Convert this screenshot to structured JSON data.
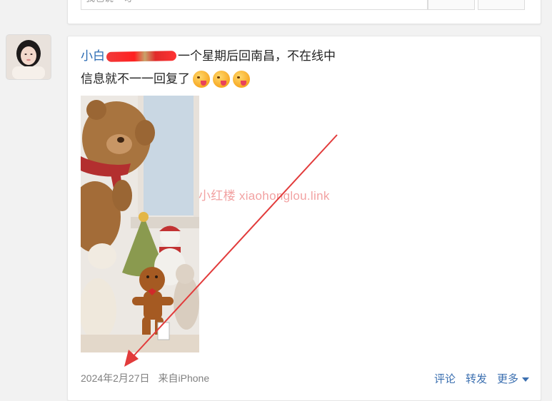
{
  "previous_post": {
    "input_placeholder": "我也说一句"
  },
  "post": {
    "username": "小白",
    "text_line1_after_redaction": "一个星期后回南昌，不在线中",
    "text_line2": "信息就不一一回复了",
    "emoji_count": 3,
    "emoji_name": "tongue-out-emoji",
    "watermark": "小红楼  xiaohonglou.link",
    "date": "2024年2月27日",
    "source": "来自iPhone",
    "actions": {
      "comment": "评论",
      "repost": "转发",
      "more": "更多"
    }
  },
  "colors": {
    "link": "#3b6fb0",
    "username": "#2a6ab3",
    "arrow": "#e23b3b",
    "watermark": "#f2a2a2"
  }
}
